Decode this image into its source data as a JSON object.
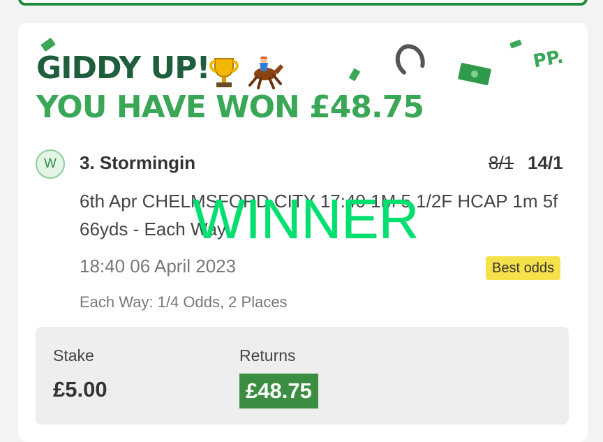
{
  "header": {
    "title": "GIDDY UP!",
    "won_message": "YOU HAVE WON £48.75",
    "trophy_emoji": "🏆",
    "horse_emoji": "🏇",
    "brand_mark": "PP."
  },
  "bet": {
    "result_badge": "W",
    "selection": "3. Stormingin",
    "old_odds": "8/1",
    "new_odds": "14/1",
    "event": "6th Apr CHELMSFORD CITY 17:40 1M 5 1/2F HCAP 1m 5f 66yds - Each Way",
    "datetime": "18:40 06 April 2023",
    "best_odds_tag": "Best odds",
    "each_way_terms": "Each Way: 1/4 Odds, 2 Places"
  },
  "summary": {
    "stake_label": "Stake",
    "stake_value": "£5.00",
    "returns_label": "Returns",
    "returns_value": "£48.75"
  },
  "overlay": {
    "watermark": "WINNER"
  },
  "colors": {
    "headline_dark": "#1e5e3c",
    "headline_green": "#3aa757",
    "returns_bg": "#3b8e41",
    "best_odds_bg": "#f7e14a",
    "watermark": "#00e070"
  }
}
